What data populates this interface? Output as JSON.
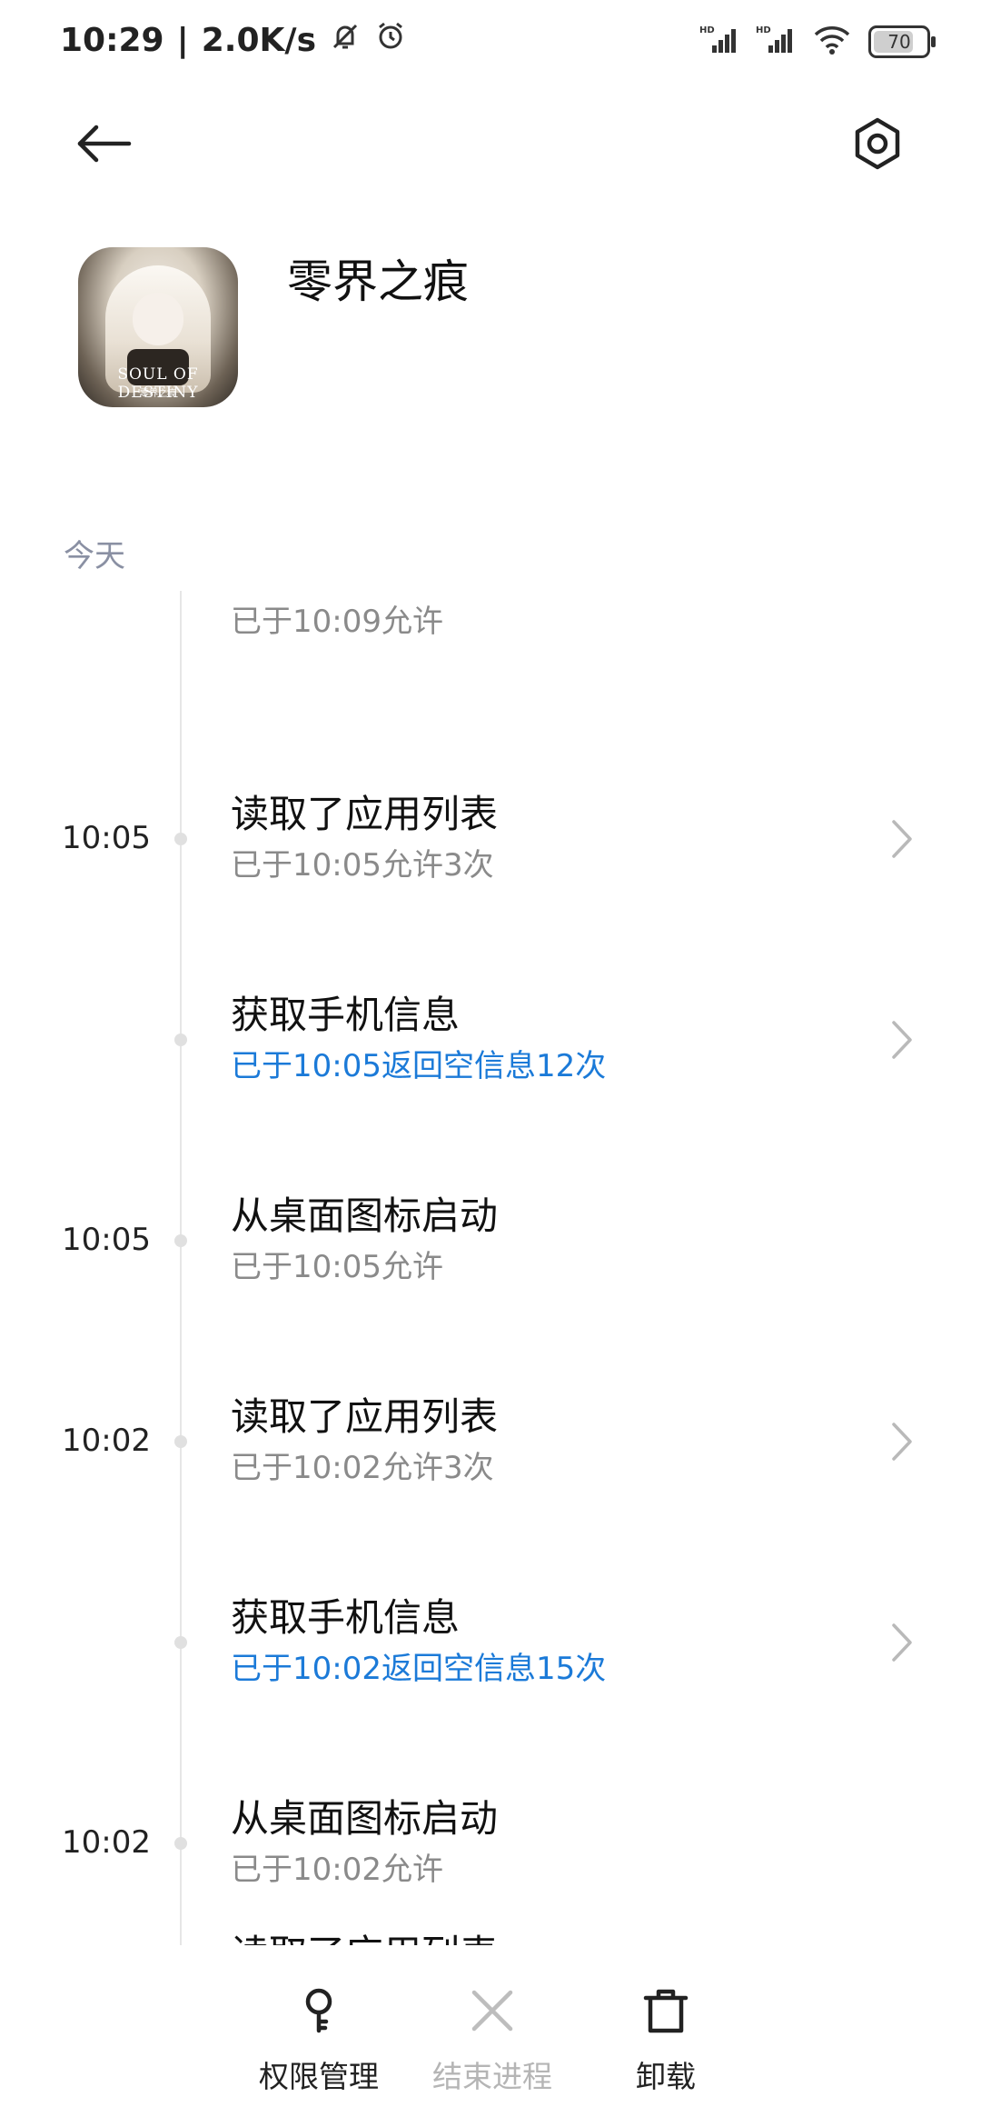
{
  "status_bar": {
    "time": "10:29",
    "speed": "2.0K/s",
    "battery_level": "70"
  },
  "app": {
    "name": "零界之痕",
    "icon_text": "SOUL OF DESTINY",
    "icon_subtext": "零界之痕"
  },
  "section": {
    "label": "今天"
  },
  "timeline": [
    {
      "time": "",
      "title": "",
      "subtitle": "已于10:09允许",
      "subtitle_highlight": false,
      "has_chevron": false
    },
    {
      "time": "10:05",
      "title": "读取了应用列表",
      "subtitle": "已于10:05允许3次",
      "subtitle_highlight": false,
      "has_chevron": true
    },
    {
      "time": "",
      "title": "获取手机信息",
      "subtitle": "已于10:05返回空信息12次",
      "subtitle_highlight": true,
      "has_chevron": true
    },
    {
      "time": "10:05",
      "title": "从桌面图标启动",
      "subtitle": "已于10:05允许",
      "subtitle_highlight": false,
      "has_chevron": false
    },
    {
      "time": "10:02",
      "title": "读取了应用列表",
      "subtitle": "已于10:02允许3次",
      "subtitle_highlight": false,
      "has_chevron": true
    },
    {
      "time": "",
      "title": "获取手机信息",
      "subtitle": "已于10:02返回空信息15次",
      "subtitle_highlight": true,
      "has_chevron": true
    },
    {
      "time": "10:02",
      "title": "从桌面图标启动",
      "subtitle": "已于10:02允许",
      "subtitle_highlight": false,
      "has_chevron": false
    },
    {
      "time": "",
      "title": "读取了应用列表",
      "subtitle": "",
      "subtitle_highlight": false,
      "has_chevron": false
    }
  ],
  "bottom_bar": {
    "permissions": "权限管理",
    "end_process": "结束进程",
    "uninstall": "卸载"
  },
  "colors": {
    "accent_blue": "#1b7ad8",
    "section_label": "#8a90a3",
    "secondary_text": "#8a8a8a"
  }
}
